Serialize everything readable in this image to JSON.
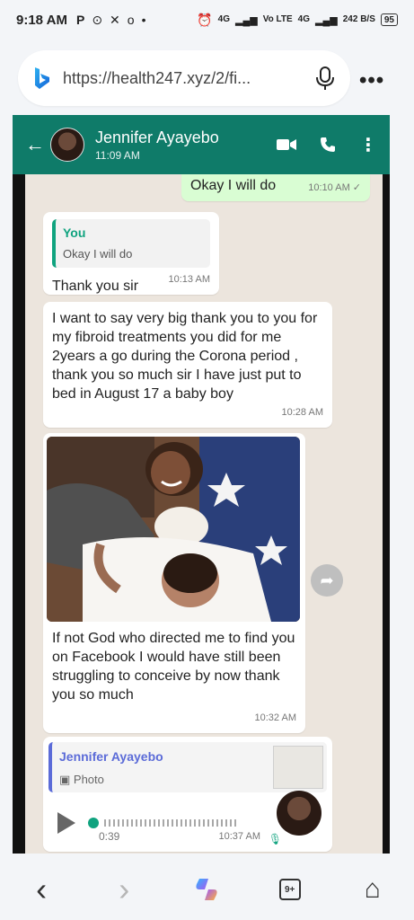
{
  "status": {
    "time": "9:18 AM",
    "left_icons": [
      "P",
      "⊙",
      "✕",
      "o",
      "•"
    ],
    "net1": "4G",
    "volte": "Vo LTE",
    "net2": "4G",
    "speed": "242 B/S",
    "battery": "95"
  },
  "browser": {
    "url": "https://health247.xyz/2/fi...",
    "more_label": "•••"
  },
  "chat": {
    "contact_name": "Jennifer Ayayebo",
    "contact_time": "11:09 AM",
    "messages": [
      {
        "text": "Okay I will do",
        "time": "10:10 AM ✓"
      },
      {
        "quote_name": "You",
        "quote_text": "Okay I will do",
        "text": "Thank you sir",
        "time": "10:13 AM"
      },
      {
        "text": "I want to say very big thank you to you for my fibroid treatments you did for me 2years a go during the Corona period , thank you so much sir I have just put to bed in August 17 a  baby boy",
        "time": "10:28 AM"
      },
      {
        "text": "If not God who directed me to find you on Facebook I would have still been struggling to conceive by now thank you so much",
        "time": "10:32 AM"
      },
      {
        "quote_name": "Jennifer Ayayebo",
        "quote_text": "▣ Photo",
        "duration": "0:39",
        "time": "10:37 AM"
      }
    ]
  },
  "nav": {
    "back": "‹",
    "forward": "›",
    "tabs": "9+",
    "home": "⌂"
  },
  "colors": {
    "wa_header": "#0f7b69",
    "wa_green": "#10a37f",
    "chat_bg": "#ece5dd",
    "outgoing": "#d9fdd3"
  }
}
